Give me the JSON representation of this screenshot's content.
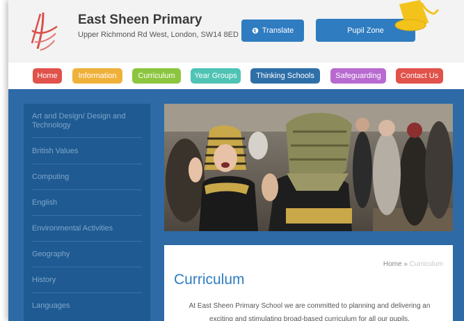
{
  "header": {
    "school_name": "East Sheen Primary",
    "address": "Upper Richmond Rd West, London, SW14 8ED",
    "translate_label": "Translate",
    "pupil_zone_label": "Pupil Zone"
  },
  "nav": {
    "items": [
      {
        "label": "Home",
        "color": "#e0524a"
      },
      {
        "label": "Information",
        "color": "#efb13a"
      },
      {
        "label": "Curriculum",
        "color": "#8cc63f"
      },
      {
        "label": "Year Groups",
        "color": "#4fc3b4"
      },
      {
        "label": "Thinking Schools",
        "color": "#2f6fa8"
      },
      {
        "label": "Safeguarding",
        "color": "#b86ad0"
      },
      {
        "label": "Contact Us",
        "color": "#e0524a"
      }
    ]
  },
  "sidebar": {
    "items": [
      {
        "label": "Art and Design/ Design and Technology"
      },
      {
        "label": "British Values"
      },
      {
        "label": "Computing"
      },
      {
        "label": "English"
      },
      {
        "label": "Environmental Activities"
      },
      {
        "label": "Geography"
      },
      {
        "label": "History"
      },
      {
        "label": "Languages"
      }
    ]
  },
  "content": {
    "breadcrumb_home": "Home",
    "breadcrumb_sep": "»",
    "breadcrumb_current": "Curriculum",
    "title": "Curriculum",
    "intro": "At East Sheen Primary School we are committed to planning and delivering an exciting and stimulating broad-based curriculum for all our pupils."
  },
  "colors": {
    "brand_blue": "#2f7cc0",
    "sidebar_bg": "#1f5a92",
    "main_bg": "#2d6aa6"
  }
}
